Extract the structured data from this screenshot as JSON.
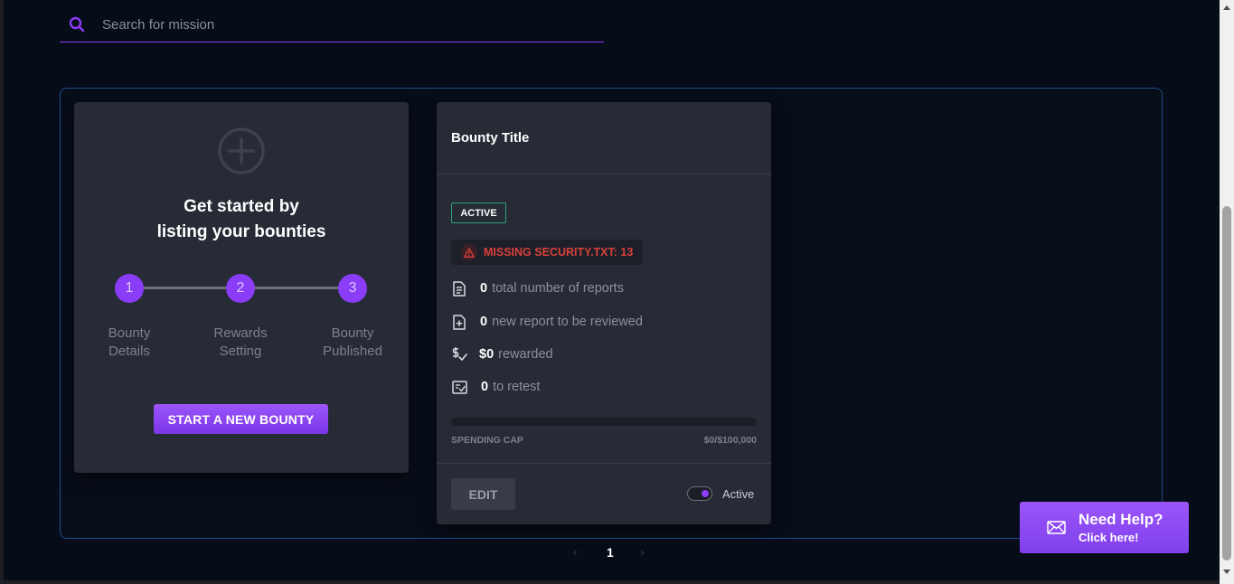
{
  "search": {
    "placeholder": "Search for mission",
    "value": ""
  },
  "start_card": {
    "title_line1": "Get started by",
    "title_line2": "listing your bounties",
    "steps": [
      {
        "number": "1",
        "label_line1": "Bounty",
        "label_line2": "Details"
      },
      {
        "number": "2",
        "label_line1": "Rewards",
        "label_line2": "Setting"
      },
      {
        "number": "3",
        "label_line1": "Bounty",
        "label_line2": "Published"
      }
    ],
    "button_label": "START A NEW BOUNTY"
  },
  "bounty_card": {
    "title": "Bounty Title",
    "status": "ACTIVE",
    "warning": "MISSING SECURITY.TXT: 13",
    "stats": [
      {
        "icon": "document-icon",
        "value": "0",
        "label": "total number of reports"
      },
      {
        "icon": "add-document-icon",
        "value": "0",
        "label": "new report to be reviewed"
      },
      {
        "icon": "dollar-check-icon",
        "value": "$0",
        "label": "rewarded"
      },
      {
        "icon": "retest-icon",
        "value": "0",
        "label": "to retest"
      }
    ],
    "spending_cap_label": "SPENDING CAP",
    "spending_cap_value": "$0/$100,000",
    "spending_progress": 0,
    "edit_label": "EDIT",
    "toggle_label": "Active",
    "toggle_on": true
  },
  "pagination": {
    "prev": "‹",
    "current": "1",
    "next": "›"
  },
  "help": {
    "title": "Need Help?",
    "subtitle": "Click here!"
  },
  "colors": {
    "accent": "#8b3cf6",
    "status_green": "#2fa37a",
    "warning_red": "#d8403b",
    "container_border": "#1f4d8c"
  }
}
